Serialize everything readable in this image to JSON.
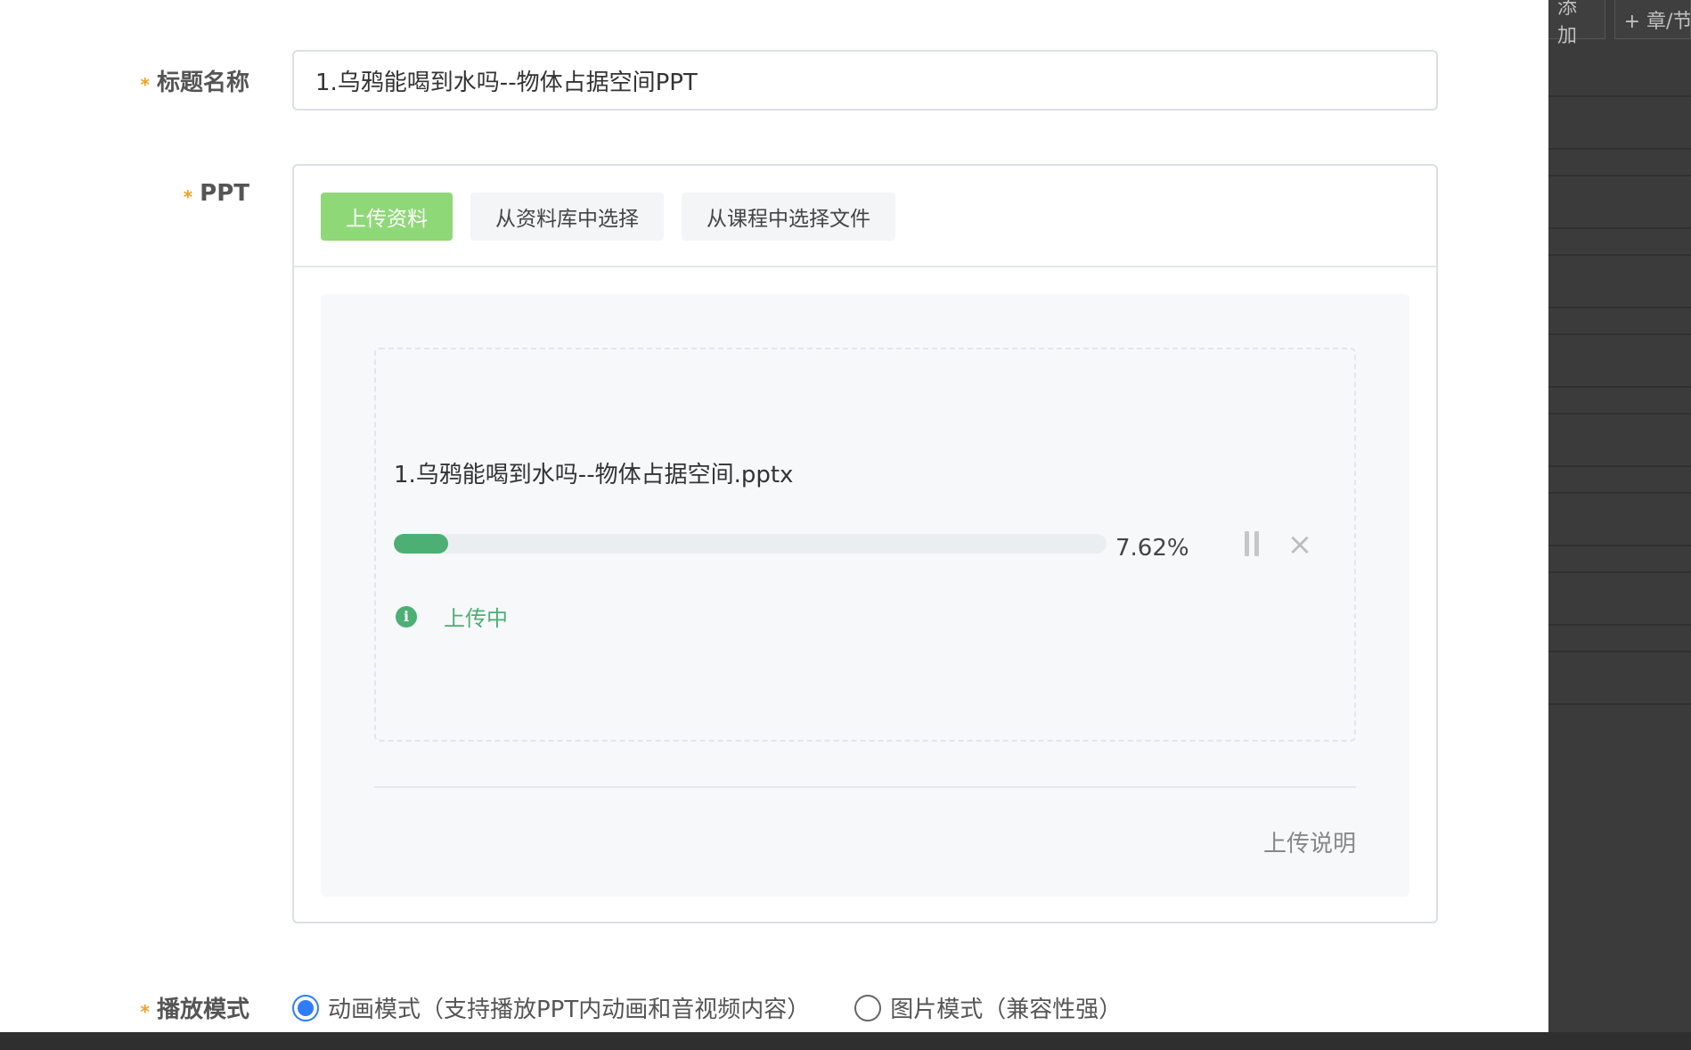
{
  "background": {
    "toolbar": {
      "add_label": "添加",
      "chapter_label": "+ 章/节"
    }
  },
  "form": {
    "title_field": {
      "label": "标题名称",
      "required_mark": "*",
      "value": "1.乌鸦能喝到水吗--物体占据空间PPT"
    },
    "ppt_field": {
      "label": "PPT",
      "required_mark": "*",
      "tabs": [
        {
          "label": "上传资料",
          "active": true
        },
        {
          "label": "从资料库中选择",
          "active": false
        },
        {
          "label": "从课程中选择文件",
          "active": false
        }
      ],
      "upload": {
        "file_name": "1.乌鸦能喝到水吗--物体占据空间.pptx",
        "progress_percent": 7.62,
        "progress_text": "7.62%",
        "status_text": "上传中",
        "pause_icon": "pause-icon",
        "cancel_icon": "close-icon",
        "info_icon": "info-icon"
      },
      "upload_note": "上传说明"
    },
    "play_mode": {
      "label": "播放模式",
      "required_mark": "*",
      "options": [
        {
          "label": "动画模式（支持播放PPT内动画和音视频内容）",
          "checked": true
        },
        {
          "label": "图片模式（兼容性强）",
          "checked": false
        }
      ]
    }
  },
  "colors": {
    "accent_green": "#4caf73",
    "active_tab": "#8fd878",
    "radio_blue": "#2f7df6",
    "required_mark": "#f0a020"
  }
}
